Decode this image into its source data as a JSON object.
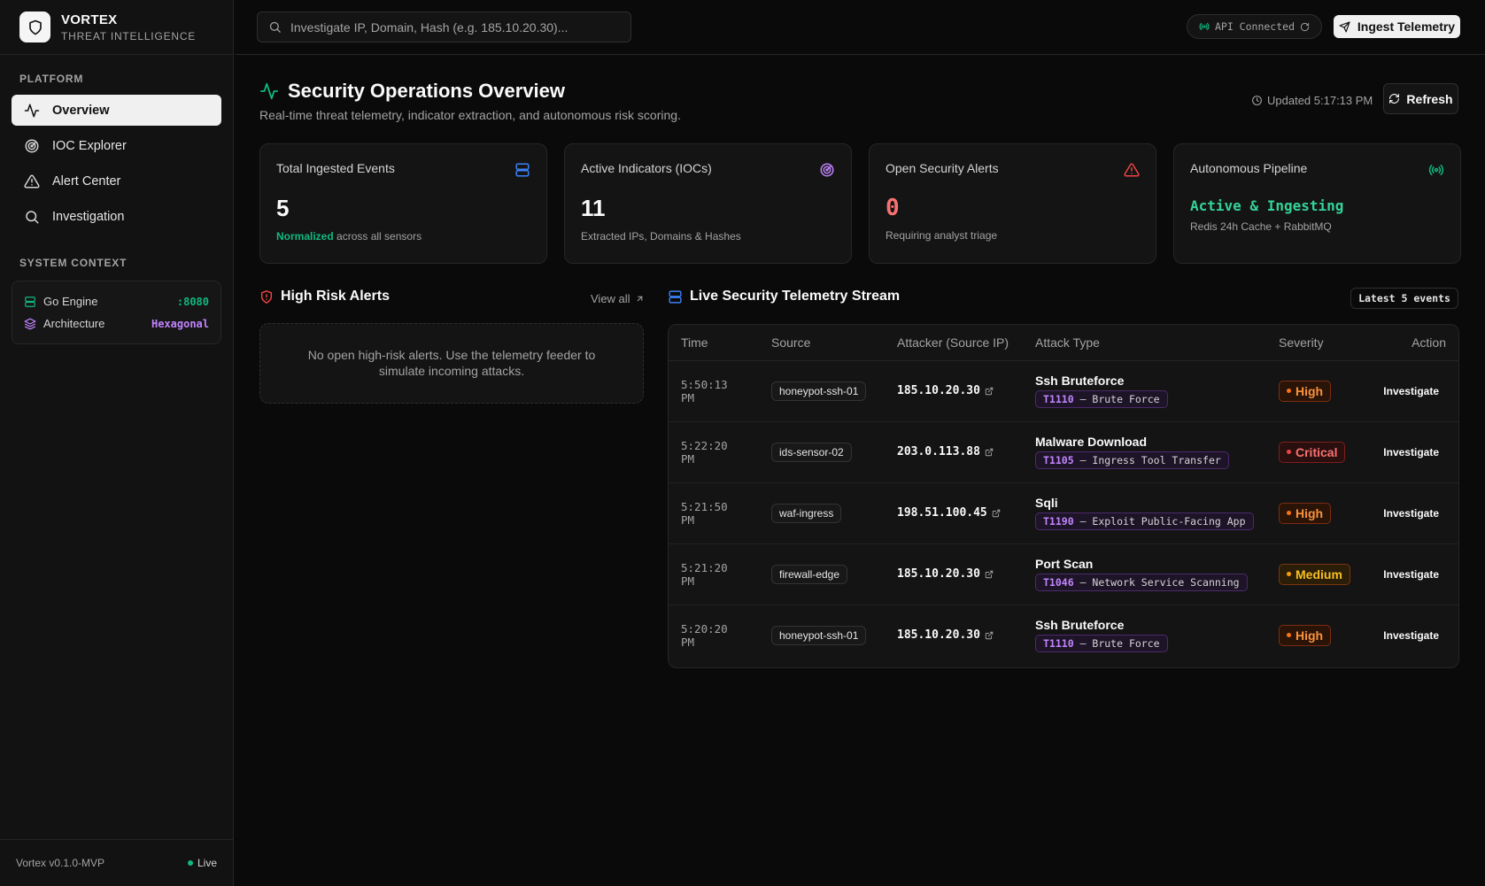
{
  "brand": {
    "name": "VORTEX",
    "subtitle": "THREAT INTELLIGENCE"
  },
  "sidebar": {
    "platform_title": "PLATFORM",
    "items": [
      {
        "label": "Overview",
        "icon": "activity-icon",
        "active": true
      },
      {
        "label": "IOC Explorer",
        "icon": "radar-icon"
      },
      {
        "label": "Alert Center",
        "icon": "alert-triangle-icon"
      },
      {
        "label": "Investigation",
        "icon": "search-icon"
      }
    ],
    "context_title": "SYSTEM CONTEXT",
    "context": [
      {
        "label": "Go Engine",
        "value": ":8080",
        "color": "#10b981"
      },
      {
        "label": "Architecture",
        "value": "Hexagonal",
        "color": "#c084fc"
      }
    ],
    "footer": {
      "version": "Vortex v0.1.0-MVP",
      "status": "Live"
    }
  },
  "topbar": {
    "search_placeholder": "Investigate IP, Domain, Hash (e.g. 185.10.20.30)...",
    "api_status": "API Connected",
    "ingest_label": "Ingest Telemetry"
  },
  "header": {
    "title": "Security Operations Overview",
    "subtitle": "Real-time threat telemetry, indicator extraction, and autonomous risk scoring.",
    "updated": "Updated 5:17:13 PM",
    "refresh_label": "Refresh"
  },
  "cards": [
    {
      "label": "Total Ingested Events",
      "value": "5",
      "note_highlight": "Normalized",
      "note": "across all sensors"
    },
    {
      "label": "Active Indicators (IOCs)",
      "value": "11",
      "note": "Extracted IPs, Domains & Hashes"
    },
    {
      "label": "Open Security Alerts",
      "value": "0",
      "note": "Requiring analyst triage"
    },
    {
      "label": "Autonomous Pipeline",
      "status": "Active & Ingesting",
      "note": "Redis 24h Cache + RabbitMQ"
    }
  ],
  "alerts_panel": {
    "title": "High Risk Alerts",
    "view_all": "View all",
    "empty_text": "No open high-risk alerts. Use the telemetry feeder to simulate incoming attacks."
  },
  "telemetry": {
    "title": "Live Security Telemetry Stream",
    "badge": "Latest 5 events",
    "columns": [
      "Time",
      "Source",
      "Attacker (Source IP)",
      "Attack Type",
      "Severity",
      "Action"
    ],
    "rows": [
      {
        "time": "5:50:13 PM",
        "source": "honeypot-ssh-01",
        "ip": "185.10.20.30",
        "type": "Ssh Bruteforce",
        "tid": "T1110",
        "technique": "— Brute Force",
        "severity": "High",
        "action": "Investigate"
      },
      {
        "time": "5:22:20 PM",
        "source": "ids-sensor-02",
        "ip": "203.0.113.88",
        "type": "Malware Download",
        "tid": "T1105",
        "technique": "— Ingress Tool Transfer",
        "severity": "Critical",
        "action": "Investigate"
      },
      {
        "time": "5:21:50 PM",
        "source": "waf-ingress",
        "ip": "198.51.100.45",
        "type": "Sqli",
        "tid": "T1190",
        "technique": "— Exploit Public-Facing App",
        "severity": "High",
        "action": "Investigate"
      },
      {
        "time": "5:21:20 PM",
        "source": "firewall-edge",
        "ip": "185.10.20.30",
        "type": "Port Scan",
        "tid": "T1046",
        "technique": "— Network Service Scanning",
        "severity": "Medium",
        "action": "Investigate"
      },
      {
        "time": "5:20:20 PM",
        "source": "honeypot-ssh-01",
        "ip": "185.10.20.30",
        "type": "Ssh Bruteforce",
        "tid": "T1110",
        "technique": "— Brute Force",
        "severity": "High",
        "action": "Investigate"
      }
    ]
  },
  "colors": {
    "accent_green": "#10b981",
    "accent_blue": "#3b82f6",
    "accent_purple": "#c084fc",
    "accent_red": "#ef4444"
  }
}
